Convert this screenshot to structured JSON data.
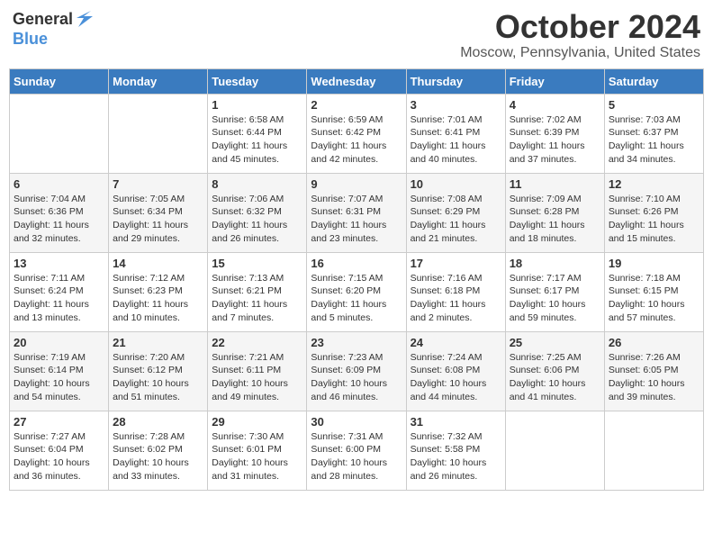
{
  "header": {
    "logo_general": "General",
    "logo_blue": "Blue",
    "month_title": "October 2024",
    "location": "Moscow, Pennsylvania, United States"
  },
  "weekdays": [
    "Sunday",
    "Monday",
    "Tuesday",
    "Wednesday",
    "Thursday",
    "Friday",
    "Saturday"
  ],
  "weeks": [
    [
      {
        "day": "",
        "sunrise": "",
        "sunset": "",
        "daylight": ""
      },
      {
        "day": "",
        "sunrise": "",
        "sunset": "",
        "daylight": ""
      },
      {
        "day": "1",
        "sunrise": "Sunrise: 6:58 AM",
        "sunset": "Sunset: 6:44 PM",
        "daylight": "Daylight: 11 hours and 45 minutes."
      },
      {
        "day": "2",
        "sunrise": "Sunrise: 6:59 AM",
        "sunset": "Sunset: 6:42 PM",
        "daylight": "Daylight: 11 hours and 42 minutes."
      },
      {
        "day": "3",
        "sunrise": "Sunrise: 7:01 AM",
        "sunset": "Sunset: 6:41 PM",
        "daylight": "Daylight: 11 hours and 40 minutes."
      },
      {
        "day": "4",
        "sunrise": "Sunrise: 7:02 AM",
        "sunset": "Sunset: 6:39 PM",
        "daylight": "Daylight: 11 hours and 37 minutes."
      },
      {
        "day": "5",
        "sunrise": "Sunrise: 7:03 AM",
        "sunset": "Sunset: 6:37 PM",
        "daylight": "Daylight: 11 hours and 34 minutes."
      }
    ],
    [
      {
        "day": "6",
        "sunrise": "Sunrise: 7:04 AM",
        "sunset": "Sunset: 6:36 PM",
        "daylight": "Daylight: 11 hours and 32 minutes."
      },
      {
        "day": "7",
        "sunrise": "Sunrise: 7:05 AM",
        "sunset": "Sunset: 6:34 PM",
        "daylight": "Daylight: 11 hours and 29 minutes."
      },
      {
        "day": "8",
        "sunrise": "Sunrise: 7:06 AM",
        "sunset": "Sunset: 6:32 PM",
        "daylight": "Daylight: 11 hours and 26 minutes."
      },
      {
        "day": "9",
        "sunrise": "Sunrise: 7:07 AM",
        "sunset": "Sunset: 6:31 PM",
        "daylight": "Daylight: 11 hours and 23 minutes."
      },
      {
        "day": "10",
        "sunrise": "Sunrise: 7:08 AM",
        "sunset": "Sunset: 6:29 PM",
        "daylight": "Daylight: 11 hours and 21 minutes."
      },
      {
        "day": "11",
        "sunrise": "Sunrise: 7:09 AM",
        "sunset": "Sunset: 6:28 PM",
        "daylight": "Daylight: 11 hours and 18 minutes."
      },
      {
        "day": "12",
        "sunrise": "Sunrise: 7:10 AM",
        "sunset": "Sunset: 6:26 PM",
        "daylight": "Daylight: 11 hours and 15 minutes."
      }
    ],
    [
      {
        "day": "13",
        "sunrise": "Sunrise: 7:11 AM",
        "sunset": "Sunset: 6:24 PM",
        "daylight": "Daylight: 11 hours and 13 minutes."
      },
      {
        "day": "14",
        "sunrise": "Sunrise: 7:12 AM",
        "sunset": "Sunset: 6:23 PM",
        "daylight": "Daylight: 11 hours and 10 minutes."
      },
      {
        "day": "15",
        "sunrise": "Sunrise: 7:13 AM",
        "sunset": "Sunset: 6:21 PM",
        "daylight": "Daylight: 11 hours and 7 minutes."
      },
      {
        "day": "16",
        "sunrise": "Sunrise: 7:15 AM",
        "sunset": "Sunset: 6:20 PM",
        "daylight": "Daylight: 11 hours and 5 minutes."
      },
      {
        "day": "17",
        "sunrise": "Sunrise: 7:16 AM",
        "sunset": "Sunset: 6:18 PM",
        "daylight": "Daylight: 11 hours and 2 minutes."
      },
      {
        "day": "18",
        "sunrise": "Sunrise: 7:17 AM",
        "sunset": "Sunset: 6:17 PM",
        "daylight": "Daylight: 10 hours and 59 minutes."
      },
      {
        "day": "19",
        "sunrise": "Sunrise: 7:18 AM",
        "sunset": "Sunset: 6:15 PM",
        "daylight": "Daylight: 10 hours and 57 minutes."
      }
    ],
    [
      {
        "day": "20",
        "sunrise": "Sunrise: 7:19 AM",
        "sunset": "Sunset: 6:14 PM",
        "daylight": "Daylight: 10 hours and 54 minutes."
      },
      {
        "day": "21",
        "sunrise": "Sunrise: 7:20 AM",
        "sunset": "Sunset: 6:12 PM",
        "daylight": "Daylight: 10 hours and 51 minutes."
      },
      {
        "day": "22",
        "sunrise": "Sunrise: 7:21 AM",
        "sunset": "Sunset: 6:11 PM",
        "daylight": "Daylight: 10 hours and 49 minutes."
      },
      {
        "day": "23",
        "sunrise": "Sunrise: 7:23 AM",
        "sunset": "Sunset: 6:09 PM",
        "daylight": "Daylight: 10 hours and 46 minutes."
      },
      {
        "day": "24",
        "sunrise": "Sunrise: 7:24 AM",
        "sunset": "Sunset: 6:08 PM",
        "daylight": "Daylight: 10 hours and 44 minutes."
      },
      {
        "day": "25",
        "sunrise": "Sunrise: 7:25 AM",
        "sunset": "Sunset: 6:06 PM",
        "daylight": "Daylight: 10 hours and 41 minutes."
      },
      {
        "day": "26",
        "sunrise": "Sunrise: 7:26 AM",
        "sunset": "Sunset: 6:05 PM",
        "daylight": "Daylight: 10 hours and 39 minutes."
      }
    ],
    [
      {
        "day": "27",
        "sunrise": "Sunrise: 7:27 AM",
        "sunset": "Sunset: 6:04 PM",
        "daylight": "Daylight: 10 hours and 36 minutes."
      },
      {
        "day": "28",
        "sunrise": "Sunrise: 7:28 AM",
        "sunset": "Sunset: 6:02 PM",
        "daylight": "Daylight: 10 hours and 33 minutes."
      },
      {
        "day": "29",
        "sunrise": "Sunrise: 7:30 AM",
        "sunset": "Sunset: 6:01 PM",
        "daylight": "Daylight: 10 hours and 31 minutes."
      },
      {
        "day": "30",
        "sunrise": "Sunrise: 7:31 AM",
        "sunset": "Sunset: 6:00 PM",
        "daylight": "Daylight: 10 hours and 28 minutes."
      },
      {
        "day": "31",
        "sunrise": "Sunrise: 7:32 AM",
        "sunset": "Sunset: 5:58 PM",
        "daylight": "Daylight: 10 hours and 26 minutes."
      },
      {
        "day": "",
        "sunrise": "",
        "sunset": "",
        "daylight": ""
      },
      {
        "day": "",
        "sunrise": "",
        "sunset": "",
        "daylight": ""
      }
    ]
  ]
}
